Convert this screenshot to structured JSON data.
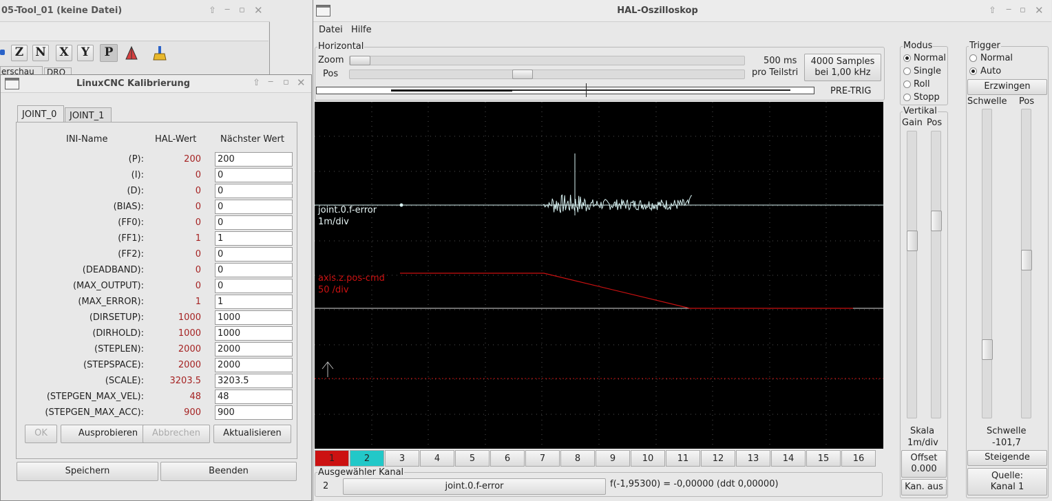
{
  "bg_window": {
    "title": "05-Tool_01 (keine Datei)",
    "toolbar_icons": [
      "Z",
      "N",
      "X",
      "Y",
      "P"
    ],
    "tabs": [
      "erschau",
      "DRO"
    ]
  },
  "calib": {
    "title": "LinuxCNC Kalibrierung",
    "tabs": [
      "JOINT_0",
      "JOINT_1"
    ],
    "headers": {
      "name": "INI-Name",
      "hal": "HAL-Wert",
      "next": "Nächster Wert"
    },
    "rows": [
      {
        "name": "(P):",
        "hal": "200",
        "next": "200"
      },
      {
        "name": "(I):",
        "hal": "0",
        "next": "0"
      },
      {
        "name": "(D):",
        "hal": "0",
        "next": "0"
      },
      {
        "name": "(BIAS):",
        "hal": "0",
        "next": "0"
      },
      {
        "name": "(FF0):",
        "hal": "0",
        "next": "0"
      },
      {
        "name": "(FF1):",
        "hal": "1",
        "next": "1"
      },
      {
        "name": "(FF2):",
        "hal": "0",
        "next": "0"
      },
      {
        "name": "(DEADBAND):",
        "hal": "0",
        "next": "0"
      },
      {
        "name": "(MAX_OUTPUT):",
        "hal": "0",
        "next": "0"
      },
      {
        "name": "(MAX_ERROR):",
        "hal": "1",
        "next": "1"
      },
      {
        "name": "(DIRSETUP):",
        "hal": "1000",
        "next": "1000"
      },
      {
        "name": "(DIRHOLD):",
        "hal": "1000",
        "next": "1000"
      },
      {
        "name": "(STEPLEN):",
        "hal": "2000",
        "next": "2000"
      },
      {
        "name": "(STEPSPACE):",
        "hal": "2000",
        "next": "2000"
      },
      {
        "name": "(SCALE):",
        "hal": "3203.5",
        "next": "3203.5"
      },
      {
        "name": "(STEPGEN_MAX_VEL):",
        "hal": "48",
        "next": "48"
      },
      {
        "name": "(STEPGEN_MAX_ACC):",
        "hal": "900",
        "next": "900"
      }
    ],
    "buttons": {
      "ok": "OK",
      "try": "Ausprobieren",
      "abort": "Abbrechen",
      "update": "Aktualisieren",
      "save": "Speichern",
      "quit": "Beenden"
    }
  },
  "scope": {
    "title": "HAL-Oszilloskop",
    "menu": [
      "Datei",
      "Hilfe"
    ],
    "horizontal": {
      "label": "Horizontal",
      "zoom": "Zoom",
      "pos": "Pos",
      "time": "500 ms",
      "per_div": "pro Teilstri",
      "samples": "4000 Samples",
      "rate": "bei 1,00 kHz",
      "pretrig": "PRE-TRIG"
    },
    "traces": [
      {
        "name": "joint.0.f-error",
        "scale": "1m/div",
        "color": "#d8f2f2"
      },
      {
        "name": "axis.z.pos-cmd",
        "scale": "50 /div",
        "color": "#cc1111"
      }
    ],
    "channels": [
      "1",
      "2",
      "3",
      "4",
      "5",
      "6",
      "7",
      "8",
      "9",
      "10",
      "11",
      "12",
      "13",
      "14",
      "15",
      "16"
    ],
    "channel_colors": {
      "1": "#cc1111",
      "2": "#22c8c8"
    },
    "selected": {
      "label": "Ausgewähler Kanal",
      "num": "2",
      "name": "joint.0.f-error",
      "readout": "f(-1,95300) = -0,00000 (ddt  0,00000)"
    },
    "mode": {
      "label": "Modus",
      "options": [
        "Normal",
        "Single",
        "Roll",
        "Stopp"
      ],
      "selected": "Normal"
    },
    "vertical": {
      "label": "Vertikal",
      "gain": "Gain",
      "pos": "Pos",
      "skala": "Skala",
      "scale_value": "1m/div",
      "offset": "Offset",
      "offset_value": "0.000",
      "chan_off": "Kan. aus"
    },
    "trigger": {
      "label": "Trigger",
      "options": [
        "Normal",
        "Auto"
      ],
      "selected": "Auto",
      "force": "Erzwingen",
      "threshold": "Schwelle",
      "pos": "Pos",
      "threshold_label": "Schwelle",
      "threshold_value": "-101,7",
      "edge": "Steigende",
      "source_label": "Quelle:",
      "source_value": "Kanal  1"
    }
  }
}
